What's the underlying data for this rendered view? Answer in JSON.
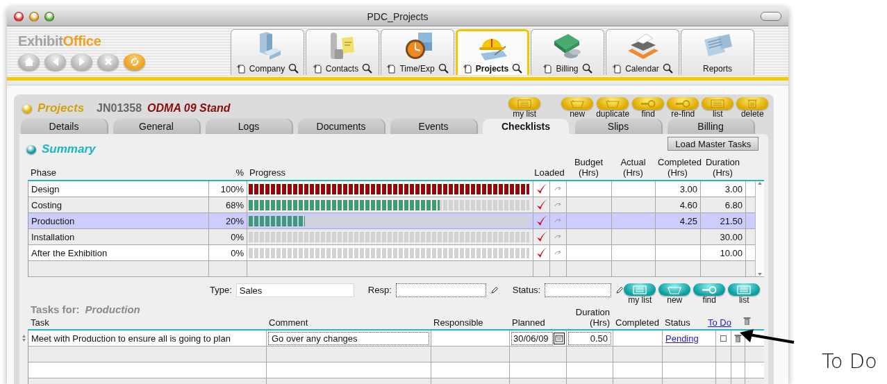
{
  "window": {
    "title": "PDC_Projects"
  },
  "logo": {
    "first": "Exhibit",
    "second": "Office"
  },
  "nav_buttons": [
    {
      "kind": "home"
    },
    {
      "kind": "back"
    },
    {
      "kind": "forward"
    },
    {
      "kind": "stop"
    },
    {
      "kind": "sync"
    }
  ],
  "modules": [
    {
      "label": "Company",
      "kind": "company",
      "selected": false,
      "actions": true
    },
    {
      "label": "Contacts",
      "kind": "contacts",
      "selected": false,
      "actions": true
    },
    {
      "label": "Time/Exp",
      "kind": "time",
      "selected": false,
      "actions": true
    },
    {
      "label": "Projects",
      "kind": "projects",
      "selected": true,
      "actions": true
    },
    {
      "label": "Billing",
      "kind": "billing",
      "selected": false,
      "actions": true
    },
    {
      "label": "Calendar",
      "kind": "calendar",
      "selected": false,
      "actions": true
    },
    {
      "label": "Reports",
      "kind": "reports",
      "selected": false,
      "actions": false
    }
  ],
  "record": {
    "section": "Projects",
    "number": "JN01358",
    "name": "ODMA 09 Stand"
  },
  "record_buttons": [
    {
      "label": "my list",
      "kind": "list"
    },
    {
      "label": "new",
      "kind": "new"
    },
    {
      "label": "duplicate",
      "kind": "new"
    },
    {
      "label": "find",
      "kind": "find"
    },
    {
      "label": "re-find",
      "kind": "find"
    },
    {
      "label": "list",
      "kind": "list"
    },
    {
      "label": "delete",
      "kind": "delete"
    }
  ],
  "tabs": [
    {
      "label": "Details",
      "selected": false
    },
    {
      "label": "General",
      "selected": false
    },
    {
      "label": "Logs",
      "selected": false
    },
    {
      "label": "Documents",
      "selected": false
    },
    {
      "label": "Events",
      "selected": false
    },
    {
      "label": "Checklists",
      "selected": true
    },
    {
      "label": "Slips",
      "selected": false
    },
    {
      "label": "Billing",
      "selected": false
    }
  ],
  "summary": {
    "title": "Summary",
    "load_button": "Load Master Tasks",
    "columns": {
      "phase": "Phase",
      "percent": "%",
      "progress": "Progress",
      "loaded": "Loaded",
      "budget": [
        "Budget",
        "(Hrs)"
      ],
      "actual": [
        "Actual",
        "(Hrs)"
      ],
      "completed": [
        "Completed",
        "(Hrs)"
      ],
      "duration": [
        "Duration",
        "(Hrs)"
      ]
    },
    "rows": [
      {
        "phase": "Design",
        "percent": "100%",
        "level": 1,
        "color": "#8b0a0a",
        "loaded": true,
        "completed": "3.00",
        "duration": "3.00",
        "selected": false
      },
      {
        "phase": "Costing",
        "percent": "68%",
        "level": 0.68,
        "color": "#3e9a72",
        "loaded": true,
        "completed": "4.60",
        "duration": "6.80",
        "selected": false
      },
      {
        "phase": "Production",
        "percent": "20%",
        "level": 0.2,
        "color": "#3e9a72",
        "loaded": true,
        "completed": "4.25",
        "duration": "21.50",
        "selected": true
      },
      {
        "phase": "Installation",
        "percent": "0%",
        "loaded": true,
        "duration": "30.00",
        "selected": false
      },
      {
        "phase": "After the Exhibition",
        "percent": "0%",
        "loaded": true,
        "duration": "10.00",
        "selected": false
      }
    ]
  },
  "tasks": {
    "filters": [
      {
        "label": "Type:",
        "value": "Sales",
        "kind": "text"
      },
      {
        "label": "Resp:",
        "kind": "lookup"
      },
      {
        "label": "Status:",
        "kind": "lookup"
      }
    ],
    "buttons": [
      {
        "label": "my list",
        "kind": "list"
      },
      {
        "label": "new",
        "kind": "new"
      },
      {
        "label": "find",
        "kind": "find"
      },
      {
        "label": "list",
        "kind": "list"
      }
    ],
    "title": "Tasks for:",
    "phase": "Production",
    "columns": {
      "task": "Task",
      "comment": "Comment",
      "responsible": "Responsible",
      "planned": "Planned",
      "duration": [
        "Duration",
        "(Hrs)"
      ],
      "completed": "Completed",
      "status": "Status",
      "todo": "To Do"
    },
    "rows": [
      {
        "task": "Meet with Production to ensure all is going to plan",
        "comment": "Go over any changes",
        "planned": "30/06/09",
        "duration": "0.50",
        "status": "Pending",
        "todo": false
      }
    ]
  },
  "annotation": {
    "text": "To Do"
  }
}
